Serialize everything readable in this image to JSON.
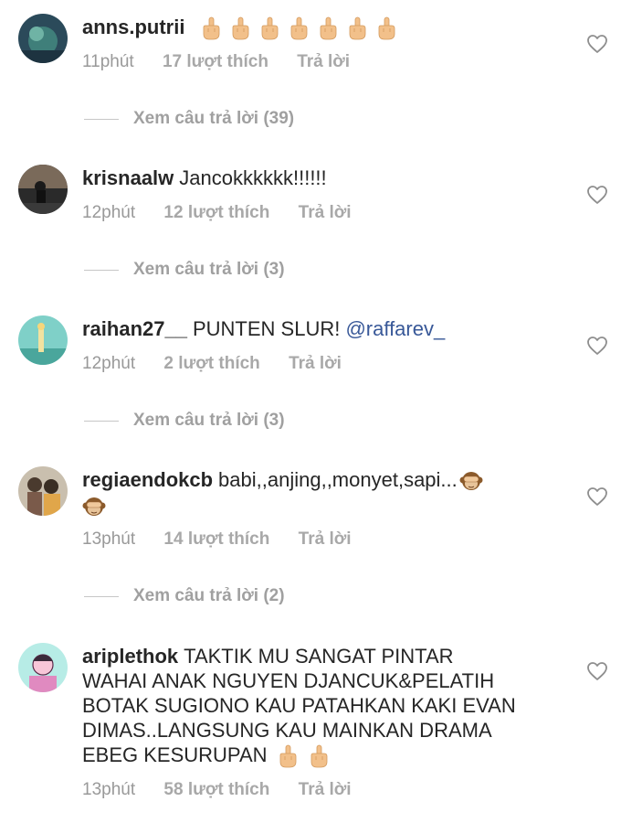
{
  "colors": {
    "text": "#262626",
    "meta": "#999999",
    "mention": "#385898",
    "divider": "#c7c7c7"
  },
  "comments": [
    {
      "username": "anns.putrii",
      "text": "",
      "emojis": [
        "middle-finger-emoji",
        "middle-finger-emoji",
        "middle-finger-emoji",
        "middle-finger-emoji",
        "middle-finger-emoji",
        "middle-finger-emoji",
        "middle-finger-emoji"
      ],
      "time": "11phút",
      "likes": "17 lượt thích",
      "reply": "Trả lời",
      "view_replies": "Xem câu trả lời (39)"
    },
    {
      "username": "krisnaalw",
      "text": "Jancokkkkkk!!!!!!",
      "time": "12phút",
      "likes": "12 lượt thích",
      "reply": "Trả lời",
      "view_replies": "Xem câu trả lời (3)"
    },
    {
      "username": "raihan27__",
      "text": "PUNTEN SLUR!",
      "mention": "@raffarev_",
      "time": "12phút",
      "likes": "2 lượt thích",
      "reply": "Trả lời",
      "view_replies": "Xem câu trả lời (3)"
    },
    {
      "username": "regiaendokcb",
      "text": "babi,,anjing,,monyet,sapi...",
      "emojis": [
        "see-no-evil-monkey-emoji",
        "see-no-evil-monkey-emoji"
      ],
      "time": "13phút",
      "likes": "14 lượt thích",
      "reply": "Trả lời",
      "view_replies": "Xem câu trả lời (2)"
    },
    {
      "username": "ariplethok",
      "text_lines": [
        "TAKTIK MU SANGAT PINTAR",
        "WAHAI ANAK NGUYEN DJANCUK&PELATIH",
        "BOTAK SUGIONO KAU PATAHKAN KAKI EVAN",
        "DIMAS..LANGSUNG KAU MAINKAN DRAMA",
        "EBEG KESURUPAN"
      ],
      "emojis": [
        "middle-finger-emoji",
        "middle-finger-emoji"
      ],
      "time": "13phút",
      "likes": "58 lượt thích",
      "reply": "Trả lời"
    }
  ]
}
